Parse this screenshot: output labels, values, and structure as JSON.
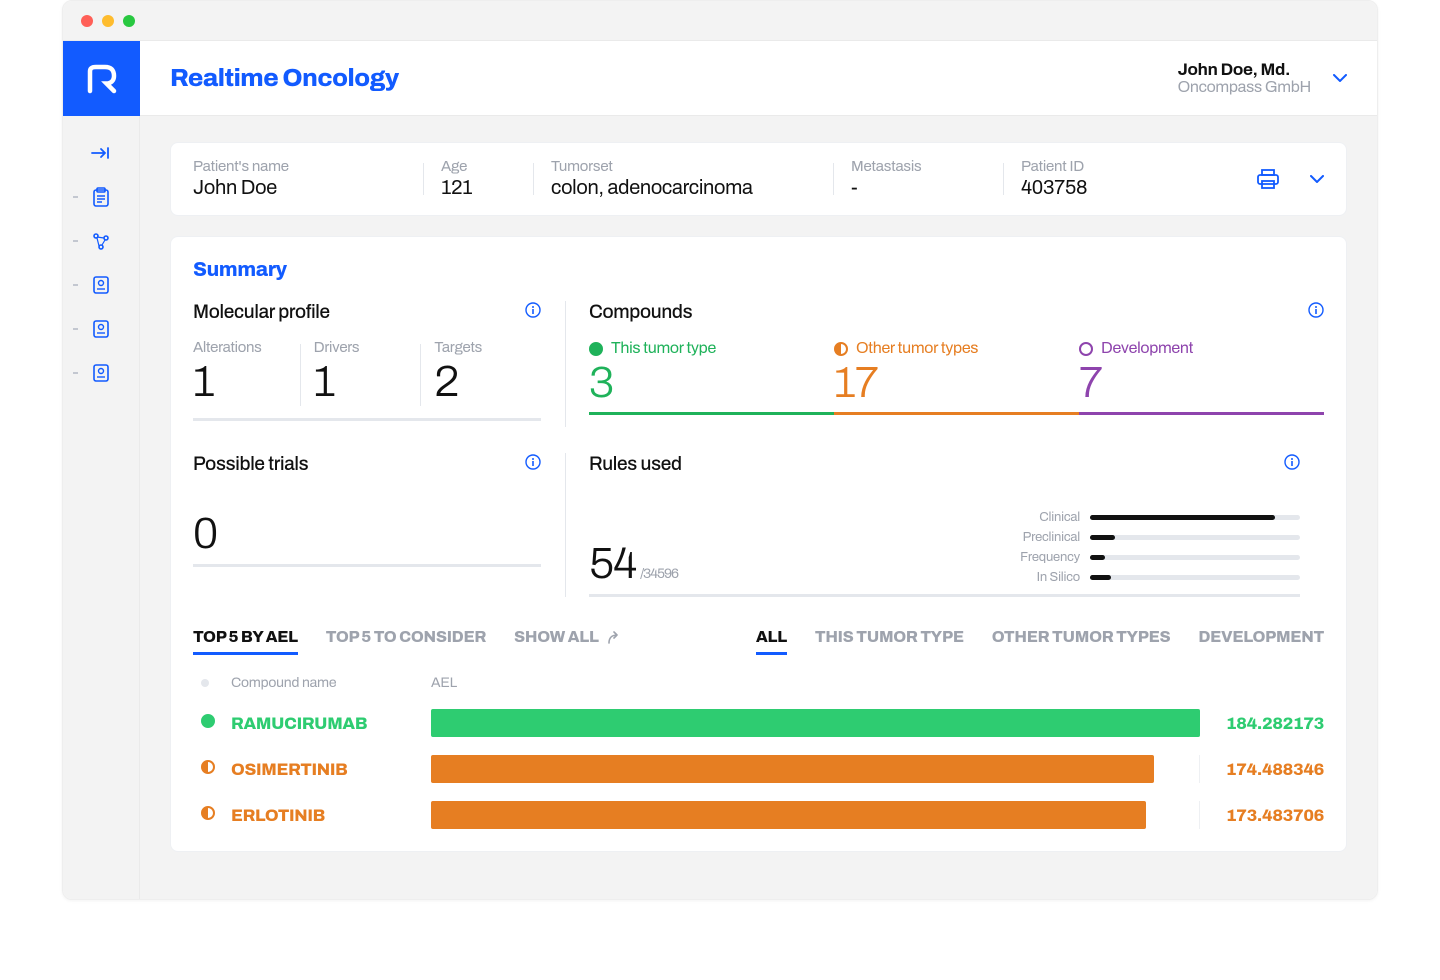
{
  "app": {
    "title": "Realtime Oncology"
  },
  "user": {
    "name": "John Doe, Md.",
    "org": "Oncompass GmbH"
  },
  "patient": {
    "name_label": "Patient's name",
    "name": "John Doe",
    "age_label": "Age",
    "age": "121",
    "tumorset_label": "Tumorset",
    "tumorset": "colon, adenocarcinoma",
    "metastasis_label": "Metastasis",
    "metastasis": "-",
    "id_label": "Patient ID",
    "id": "403758"
  },
  "summary": {
    "title": "Summary",
    "molecular_profile": {
      "title": "Molecular profile",
      "alterations_label": "Alterations",
      "alterations": "1",
      "drivers_label": "Drivers",
      "drivers": "1",
      "targets_label": "Targets",
      "targets": "2"
    },
    "compounds": {
      "title": "Compounds",
      "this_tumor_label": "This tumor type",
      "this_tumor": "3",
      "other_tumor_label": "Other tumor types",
      "other_tumor": "17",
      "development_label": "Development",
      "development": "7"
    },
    "possible_trials": {
      "title": "Possible trials",
      "value": "0"
    },
    "rules": {
      "title": "Rules used",
      "value": "54",
      "denom": "/34596",
      "bars": {
        "clinical_label": "Clinical",
        "clinical_pct": 88,
        "preclinical_label": "Preclinical",
        "preclinical_pct": 12,
        "frequency_label": "Frequency",
        "frequency_pct": 7,
        "insilico_label": "In Silico",
        "insilico_pct": 10
      }
    }
  },
  "tabs_left": {
    "top5_ael": "TOP 5 BY AEL",
    "top5_consider": "TOP 5 TO CONSIDER",
    "show_all": "SHOW ALL"
  },
  "tabs_right": {
    "all": "ALL",
    "this_tumor": "THIS TUMOR TYPE",
    "other_tumor": "OTHER TUMOR TYPES",
    "development": "DEVELOPMENT"
  },
  "table": {
    "col_name": "Compound name",
    "col_ael": "AEL",
    "rows": [
      {
        "name": "RAMUCIRUMAB",
        "ael": "184.282173",
        "color": "green",
        "pct": 100
      },
      {
        "name": "OSIMERTINIB",
        "ael": "174.488346",
        "color": "orange",
        "pct": 94
      },
      {
        "name": "ERLOTINIB",
        "ael": "173.483706",
        "color": "orange",
        "pct": 93
      }
    ]
  }
}
